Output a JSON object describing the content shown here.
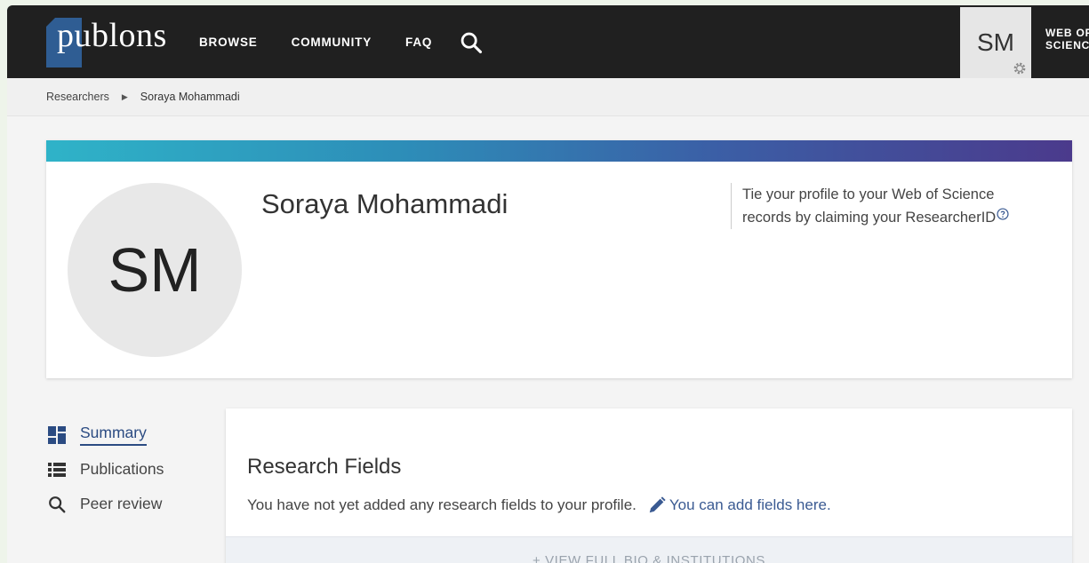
{
  "header": {
    "logo_text": "publons",
    "nav": [
      "BROWSE",
      "COMMUNITY",
      "FAQ"
    ],
    "user_initials": "SM",
    "wos_line1": "WEB OF",
    "wos_line2": "SCIENCE"
  },
  "breadcrumb": {
    "parent": "Researchers",
    "current": "Soraya Mohammadi"
  },
  "profile": {
    "initials": "SM",
    "name": "Soraya Mohammadi",
    "claim_line1": "Tie your profile to your Web of Science",
    "claim_line2": "records by claiming your ResearcherID"
  },
  "sidenav": {
    "items": [
      {
        "label": "Summary",
        "icon": "dashboard-icon"
      },
      {
        "label": "Publications",
        "icon": "list-icon"
      },
      {
        "label": "Peer review",
        "icon": "search-icon"
      }
    ]
  },
  "research_fields": {
    "title": "Research Fields",
    "empty_text": "You have not yet added any research fields to your profile.",
    "add_link": "You can add fields here.",
    "bio_link": "+ VIEW FULL BIO & INSTITUTIONS"
  },
  "colors": {
    "header_bg": "#202020",
    "accent": "#2b4b82",
    "logo_blue": "#2f5d93"
  }
}
